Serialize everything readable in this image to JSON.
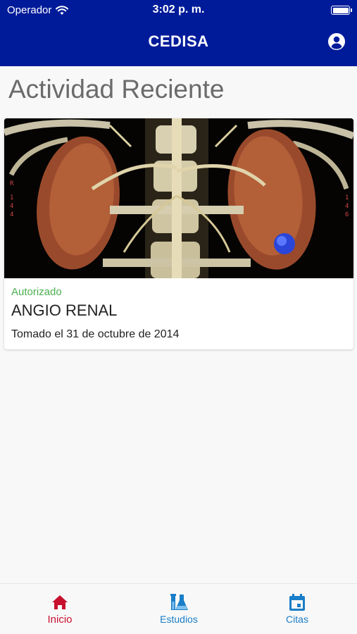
{
  "status_bar": {
    "carrier": "Operador",
    "time": "3:02 p. m."
  },
  "header": {
    "title": "CEDISA"
  },
  "main": {
    "section_title": "Actividad Reciente",
    "cards": [
      {
        "status": "Autorizado",
        "status_color": "#4caf50",
        "title": "ANGIO RENAL",
        "date": "Tomado el 31 de octubre de 2014"
      }
    ]
  },
  "tabbar": {
    "tabs": [
      {
        "label": "Inicio",
        "icon": "home-icon",
        "active": true
      },
      {
        "label": "Estudios",
        "icon": "flask-icon",
        "active": false
      },
      {
        "label": "Citas",
        "icon": "calendar-icon",
        "active": false
      }
    ],
    "active_color": "#c8102e",
    "inactive_color": "#1a7ec8"
  },
  "colors": {
    "header_bg": "#001b9a"
  }
}
